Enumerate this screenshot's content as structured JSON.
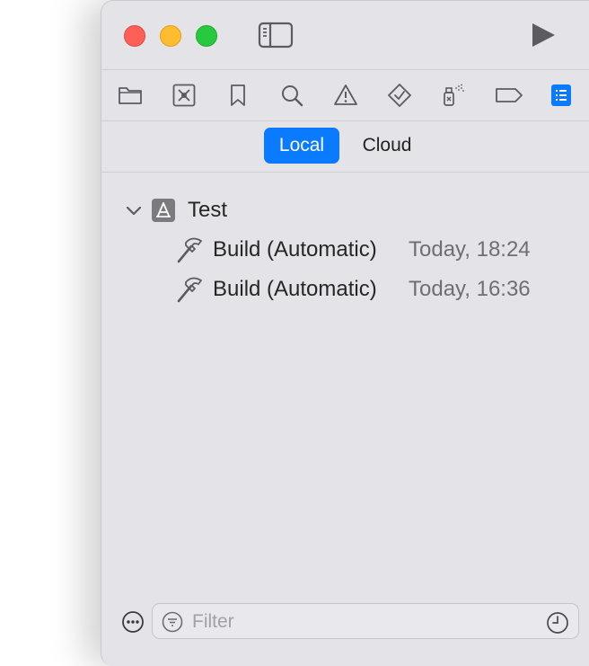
{
  "window": {
    "toolbar": {
      "buttons": [
        "close",
        "minimize",
        "maximize"
      ],
      "sidebar_icon": "sidebar-left-icon",
      "run_icon": "play-icon"
    },
    "navigators": [
      {
        "icon": "folder-icon"
      },
      {
        "icon": "source-control-icon"
      },
      {
        "icon": "bookmark-icon"
      },
      {
        "icon": "magnifying-glass-icon"
      },
      {
        "icon": "warning-triangle-icon"
      },
      {
        "icon": "test-diamond-icon"
      },
      {
        "icon": "debug-spray-icon"
      },
      {
        "icon": "breakpoint-tag-icon"
      },
      {
        "icon": "report-list-icon",
        "selected": true
      }
    ],
    "accent_color": "#0a7aff"
  },
  "scope": {
    "local_label": "Local",
    "cloud_label": "Cloud",
    "selected": "Local"
  },
  "tree": {
    "project": {
      "name": "Test",
      "expanded": true
    },
    "builds": [
      {
        "label": "Build (Automatic)",
        "time": "Today, 18:24"
      },
      {
        "label": "Build (Automatic)",
        "time": "Today, 16:36"
      }
    ]
  },
  "footer": {
    "filter_placeholder": "Filter",
    "more_icon": "ellipsis-circle-icon",
    "recent_icon": "clock-icon"
  }
}
